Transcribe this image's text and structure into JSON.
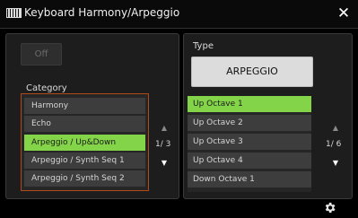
{
  "window": {
    "title": "Keyboard Harmony/Arpeggio",
    "icon": "keyboard-icon",
    "close_glyph": "✕"
  },
  "left_panel": {
    "off_button": "Off",
    "category_label": "Category",
    "items": [
      "Harmony",
      "Echo",
      "Arpeggio / Up&Down",
      "Arpeggio / Synth Seq 1",
      "Arpeggio / Synth Seq 2"
    ],
    "selected_index": 2,
    "page": "1/ 3",
    "scroll_up": "▲",
    "scroll_down": "▼"
  },
  "right_panel": {
    "type_label": "Type",
    "type_value": "ARPEGGIO",
    "items": [
      "Up Octave 1",
      "Up Octave 2",
      "Up Octave 3",
      "Up Octave 4",
      "Down Octave 1"
    ],
    "selected_index": 0,
    "page": "1/ 6",
    "scroll_up": "▲",
    "scroll_down": "▼"
  },
  "footer": {
    "settings_icon": "gear-icon"
  },
  "colors": {
    "selected": "#84d44a",
    "category_border": "#b04a18",
    "background": "#000000"
  }
}
